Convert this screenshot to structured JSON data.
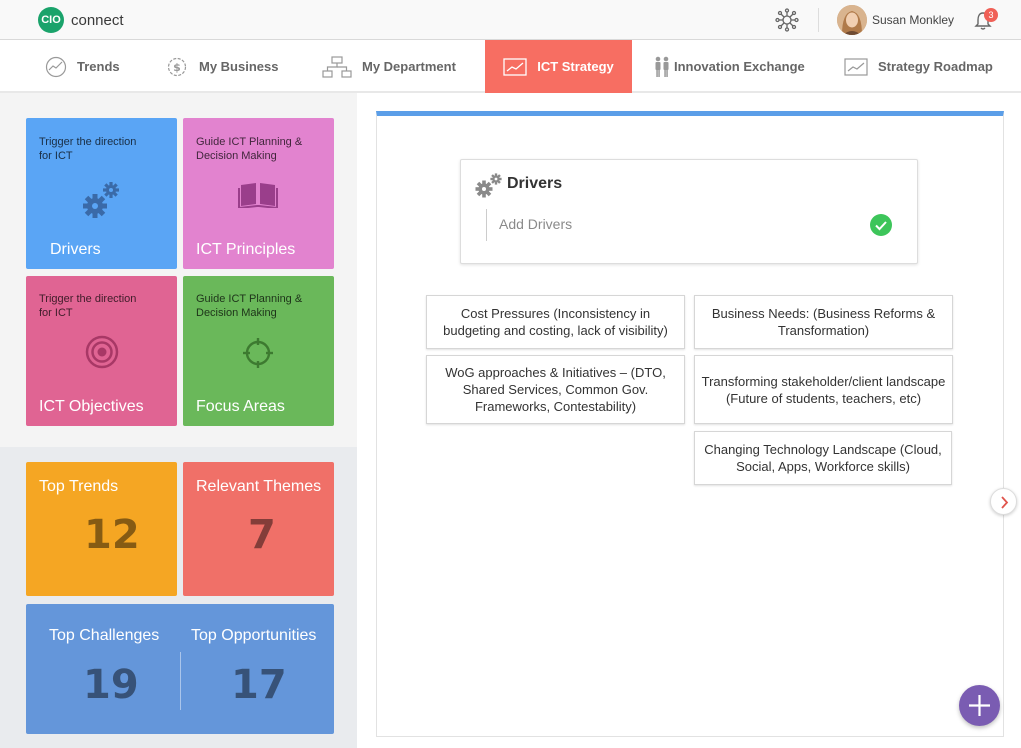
{
  "header": {
    "logo_badge": "CIO",
    "logo_text": "connect",
    "user_name": "Susan Monkley",
    "notification_count": "3",
    "icons": [
      "network-icon",
      "avatar",
      "bell-icon"
    ]
  },
  "nav": {
    "items": [
      {
        "label": "Trends",
        "icon": "trend-line-icon"
      },
      {
        "label": "My Business",
        "icon": "dollar-gear-icon"
      },
      {
        "label": "My Department",
        "icon": "org-chart-icon"
      },
      {
        "label": "ICT Strategy",
        "icon": "chart-icon",
        "active": true
      },
      {
        "label": "Innovation Exchange",
        "icon": "people-icon"
      },
      {
        "label": "Strategy Roadmap",
        "icon": "roadmap-chart-icon"
      }
    ]
  },
  "tiles": {
    "drivers": {
      "subtitle": "Trigger the direction for ICT",
      "title": "Drivers",
      "color": "#5aa5f5"
    },
    "principles": {
      "subtitle": "Guide ICT Planning & Decision Making",
      "title": "ICT Principles",
      "color": "#e283cf"
    },
    "objectives": {
      "subtitle": "Trigger the direction for ICT",
      "title": "ICT Objectives",
      "color": "#e06493"
    },
    "focus": {
      "subtitle": "Guide ICT Planning & Decision Making",
      "title": "Focus Areas",
      "color": "#6ab85a"
    }
  },
  "stats": {
    "top_trends": {
      "label": "Top Trends",
      "value": "12",
      "color": "#f5a623"
    },
    "relevant_themes": {
      "label": "Relevant Themes",
      "value": "7",
      "color": "#f07068"
    },
    "top_challenges": {
      "label": "Top Challenges",
      "value": "19"
    },
    "top_opportunities": {
      "label": "Top Opportunities",
      "value": "17"
    },
    "bottom_color": "#6496da"
  },
  "main": {
    "section_title": "Drivers",
    "input_placeholder": "Add Drivers",
    "drivers": [
      "Cost Pressures (Inconsistency in budgeting and costing, lack of visibility)",
      "Business Needs: (Business Reforms & Transformation)",
      "WoG approaches & Initiatives – (DTO, Shared Services, Common Gov. Frameworks, Contestability)",
      "Transforming stakeholder/client landscape (Future of students, teachers, etc)",
      "Changing Technology Landscape (Cloud, Social, Apps, Workforce skills)"
    ]
  }
}
